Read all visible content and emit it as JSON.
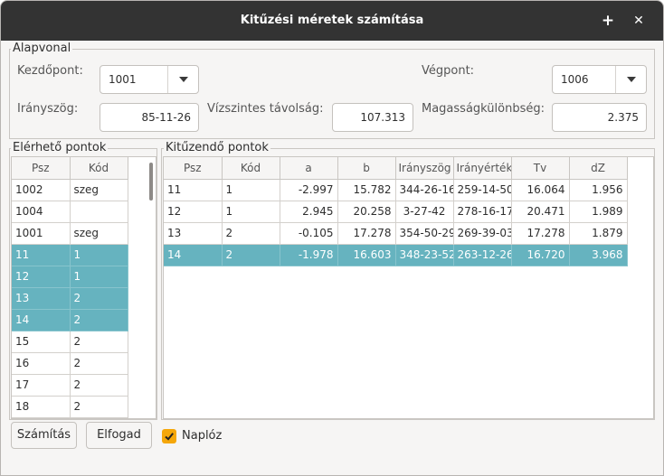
{
  "window": {
    "title": "Kitűzési méretek számítása",
    "maximize_glyph": "+",
    "close_glyph": "✕"
  },
  "baseline": {
    "group_label": "Alapvonal",
    "start_label": "Kezdőpont:",
    "start_value": "1001",
    "end_label": "Végpont:",
    "end_value": "1006",
    "bearing_label": "Irányszög:",
    "bearing_value": "85-11-26",
    "distance_label": "Vízszintes távolság:",
    "distance_value": "107.313",
    "height_label": "Magasságkülönbség:",
    "height_value": "2.375"
  },
  "available": {
    "group_label": "Elérhető pontok",
    "headers": [
      "Psz",
      "Kód"
    ],
    "rows": [
      {
        "psz": "1002",
        "kod": "szeg",
        "selected": false
      },
      {
        "psz": "1004",
        "kod": "",
        "selected": false
      },
      {
        "psz": "1001",
        "kod": "szeg",
        "selected": false
      },
      {
        "psz": "11",
        "kod": "1",
        "selected": true
      },
      {
        "psz": "12",
        "kod": "1",
        "selected": true
      },
      {
        "psz": "13",
        "kod": "2",
        "selected": true
      },
      {
        "psz": "14",
        "kod": "2",
        "selected": true
      },
      {
        "psz": "15",
        "kod": "2",
        "selected": false
      },
      {
        "psz": "16",
        "kod": "2",
        "selected": false
      },
      {
        "psz": "17",
        "kod": "2",
        "selected": false
      },
      {
        "psz": "18",
        "kod": "2",
        "selected": false
      }
    ]
  },
  "stakeout": {
    "group_label": "Kitűzendő pontok",
    "headers": [
      "Psz",
      "Kód",
      "a",
      "b",
      "Irányszög",
      "Irányérték",
      "Tv",
      "dZ"
    ],
    "rows": [
      {
        "cells": [
          "11",
          "1",
          "-2.997",
          "15.782",
          "344-26-16",
          "259-14-50",
          "16.064",
          "1.956"
        ],
        "selected": false
      },
      {
        "cells": [
          "12",
          "1",
          "2.945",
          "20.258",
          "3-27-42",
          "278-16-17",
          "20.471",
          "1.989"
        ],
        "selected": false
      },
      {
        "cells": [
          "13",
          "2",
          "-0.105",
          "17.278",
          "354-50-29",
          "269-39-03",
          "17.278",
          "1.879"
        ],
        "selected": false
      },
      {
        "cells": [
          "14",
          "2",
          "-1.978",
          "16.603",
          "348-23-52",
          "263-12-26",
          "16.720",
          "3.968"
        ],
        "selected": true
      }
    ]
  },
  "footer": {
    "calc_label": "Számítás",
    "accept_label": "Elfogad",
    "log_label": "Naplóz",
    "log_checked": true
  },
  "colors": {
    "selection": "#66b3bf",
    "checkbox": "#f5a70a",
    "titlebar": "#333333"
  }
}
